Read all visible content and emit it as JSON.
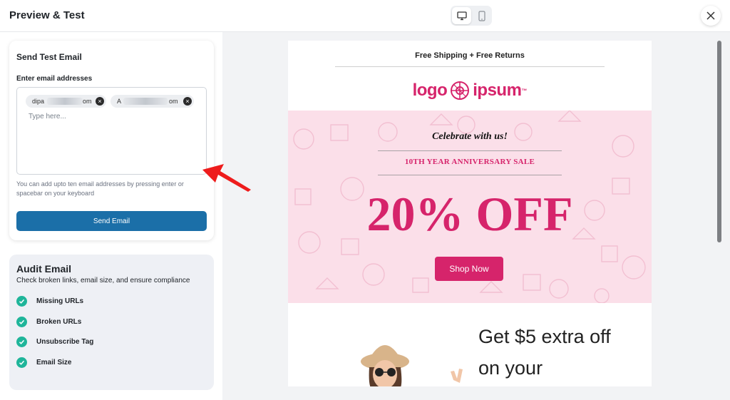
{
  "header": {
    "title": "Preview & Test",
    "device_toggle": {
      "desktop_icon": "monitor-icon",
      "mobile_icon": "smartphone-icon",
      "selected": "desktop"
    },
    "close_icon": "close-icon"
  },
  "send_test": {
    "title": "Send Test Email",
    "label": "Enter email addresses",
    "chips": [
      {
        "prefix": "dipa",
        "suffix": "om"
      },
      {
        "prefix": "A",
        "suffix": "om"
      }
    ],
    "placeholder": "Type here...",
    "hint": "You can add upto ten email addresses by pressing enter or spacebar on your keyboard",
    "button": "Send Email"
  },
  "audit": {
    "title": "Audit Email",
    "subtitle": "Check broken links, email size, and ensure compliance",
    "items": [
      "Missing URLs",
      "Broken URLs",
      "Unsubscribe Tag",
      "Email Size"
    ]
  },
  "email_preview": {
    "shipping": "Free Shipping + Free Returns",
    "logo_left": "logo",
    "logo_right": "ipsum",
    "logo_tm": "™",
    "hero": {
      "celebrate": "Celebrate with us!",
      "anniversary": "10TH YEAR ANNIVERSARY SALE",
      "discount": "20% OFF",
      "cta": "Shop Now"
    },
    "promo_line1": "Get $5 extra off",
    "promo_line2": "on your"
  },
  "colors": {
    "brand_pink": "#d6246b",
    "send_button": "#1b6fa8",
    "check_green": "#1fb59a",
    "hero_bg": "#fbdfe9",
    "annotation_arrow": "#ee1c1c"
  }
}
